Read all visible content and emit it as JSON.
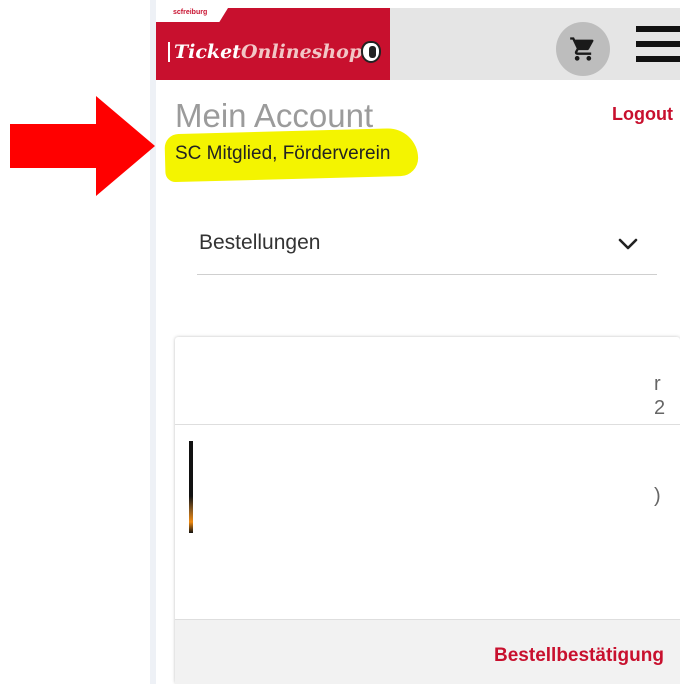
{
  "header": {
    "brand_small": "scfreiburg",
    "brand_name_part1": "Ticket",
    "brand_name_part2": "Onlineshop",
    "cart_icon": "cart-icon",
    "menu_icon": "hamburger-menu-icon"
  },
  "account": {
    "title": "Mein Account",
    "logout_label": "Logout",
    "membership": "SC Mitglied, Förderverein"
  },
  "orders": {
    "label": "Bestellungen",
    "chevron_icon": "chevron-down-icon"
  },
  "card": {
    "fragment_1": "r",
    "fragment_2": "2",
    "fragment_3": ")",
    "confirm_label": "Bestellbestätigung"
  },
  "colors": {
    "brand": "#c8102e",
    "highlight": "#f4f400",
    "arrow": "#ff0000"
  }
}
